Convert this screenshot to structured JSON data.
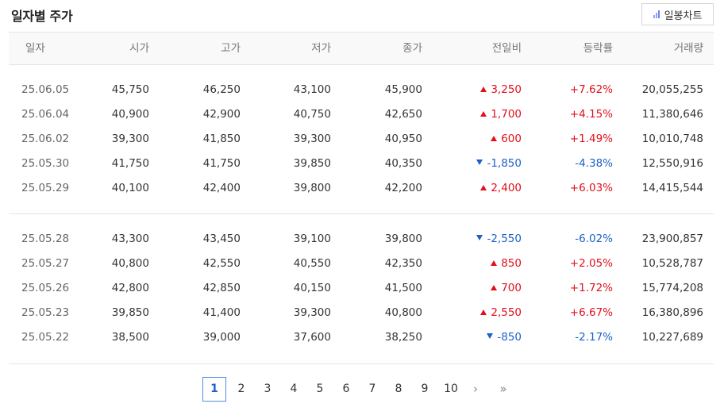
{
  "header": {
    "title": "일자별 주가",
    "chart_button_label": "일봉차트",
    "chart_button_icon": "bar-chart-icon"
  },
  "columns": [
    "일자",
    "시가",
    "고가",
    "저가",
    "종가",
    "전일비",
    "등락률",
    "거래량"
  ],
  "colors": {
    "up": "#e2101b",
    "down": "#1c61c7",
    "accent": "#4f8fe3"
  },
  "group1": [
    {
      "date": "25.06.05",
      "open": "45,750",
      "high": "46,250",
      "low": "43,100",
      "close": "45,900",
      "direction": "up",
      "change": "3,250",
      "rate": "+7.62%",
      "volume": "20,055,255"
    },
    {
      "date": "25.06.04",
      "open": "40,900",
      "high": "42,900",
      "low": "40,750",
      "close": "42,650",
      "direction": "up",
      "change": "1,700",
      "rate": "+4.15%",
      "volume": "11,380,646"
    },
    {
      "date": "25.06.02",
      "open": "39,300",
      "high": "41,850",
      "low": "39,300",
      "close": "40,950",
      "direction": "up",
      "change": "600",
      "rate": "+1.49%",
      "volume": "10,010,748"
    },
    {
      "date": "25.05.30",
      "open": "41,750",
      "high": "41,750",
      "low": "39,850",
      "close": "40,350",
      "direction": "down",
      "change": "-1,850",
      "rate": "-4.38%",
      "volume": "12,550,916"
    },
    {
      "date": "25.05.29",
      "open": "40,100",
      "high": "42,400",
      "low": "39,800",
      "close": "42,200",
      "direction": "up",
      "change": "2,400",
      "rate": "+6.03%",
      "volume": "14,415,544"
    }
  ],
  "group2": [
    {
      "date": "25.05.28",
      "open": "43,300",
      "high": "43,450",
      "low": "39,100",
      "close": "39,800",
      "direction": "down",
      "change": "-2,550",
      "rate": "-6.02%",
      "volume": "23,900,857"
    },
    {
      "date": "25.05.27",
      "open": "40,800",
      "high": "42,550",
      "low": "40,550",
      "close": "42,350",
      "direction": "up",
      "change": "850",
      "rate": "+2.05%",
      "volume": "10,528,787"
    },
    {
      "date": "25.05.26",
      "open": "42,800",
      "high": "42,850",
      "low": "40,150",
      "close": "41,500",
      "direction": "up",
      "change": "700",
      "rate": "+1.72%",
      "volume": "15,774,208"
    },
    {
      "date": "25.05.23",
      "open": "39,850",
      "high": "41,400",
      "low": "39,300",
      "close": "40,800",
      "direction": "up",
      "change": "2,550",
      "rate": "+6.67%",
      "volume": "16,380,896"
    },
    {
      "date": "25.05.22",
      "open": "38,500",
      "high": "39,000",
      "low": "37,600",
      "close": "38,250",
      "direction": "down",
      "change": "-850",
      "rate": "-2.17%",
      "volume": "10,227,689"
    }
  ],
  "pagination": {
    "pages": [
      "1",
      "2",
      "3",
      "4",
      "5",
      "6",
      "7",
      "8",
      "9",
      "10"
    ],
    "current": "1",
    "next_label": "›",
    "last_label": "»"
  }
}
